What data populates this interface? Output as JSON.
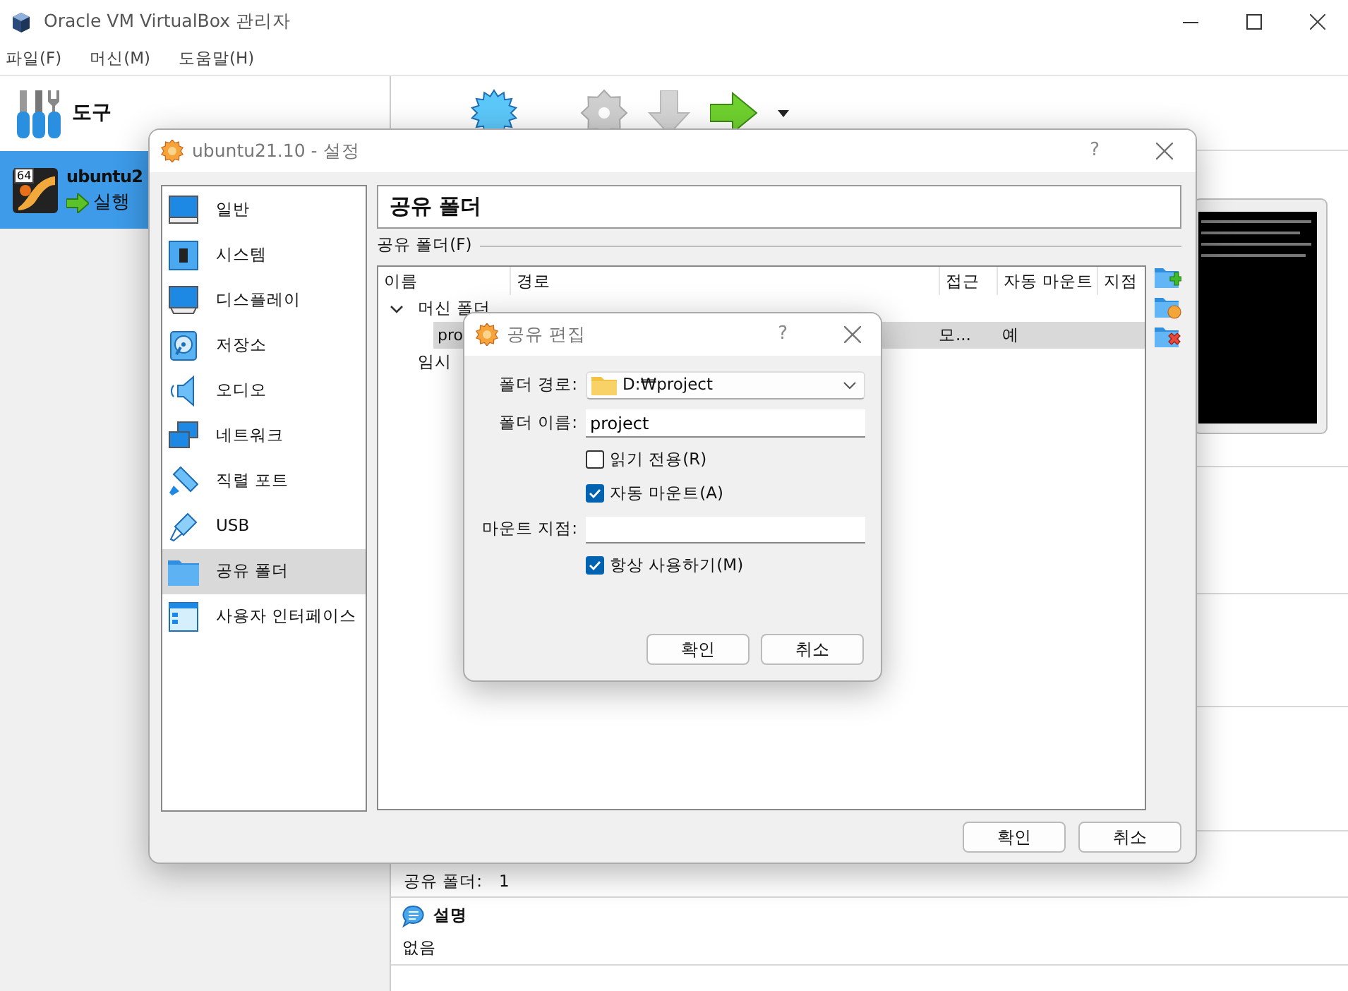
{
  "window": {
    "title": "Oracle VM VirtualBox 관리자"
  },
  "menu": [
    "파일(F)",
    "머신(M)",
    "도움말(H)"
  ],
  "sidebar": {
    "items": [
      {
        "kind": "tools",
        "label": "도구",
        "selected": false
      },
      {
        "kind": "vm",
        "label": "ubuntu2",
        "badge": "64",
        "status": "실행",
        "selected": true
      }
    ]
  },
  "details": {
    "shared_folders_label": "공유 폴더:",
    "shared_folders_value": "1",
    "description_heading": "설명",
    "description_text": "없음"
  },
  "settings_dialog": {
    "title": "ubuntu21.10 - 설정",
    "help": "?",
    "categories": [
      {
        "label": "일반",
        "selected": false
      },
      {
        "label": "시스템",
        "selected": false
      },
      {
        "label": "디스플레이",
        "selected": false
      },
      {
        "label": "저장소",
        "selected": false
      },
      {
        "label": "오디오",
        "selected": false
      },
      {
        "label": "네트워크",
        "selected": false
      },
      {
        "label": "직렬 포트",
        "selected": false
      },
      {
        "label": "USB",
        "selected": false
      },
      {
        "label": "공유 폴더",
        "selected": true
      },
      {
        "label": "사용자 인터페이스",
        "selected": false
      }
    ],
    "page_title": "공유 폴더",
    "group_label": "공유 폴더(F)",
    "table": {
      "columns": [
        "이름",
        "경로",
        "접근",
        "자동 마운트",
        "지점"
      ],
      "rows": [
        {
          "name": "머신 폴더",
          "expanded": true,
          "children": [
            {
              "name": "pro",
              "access": "모...",
              "auto_mount": "예",
              "selected": true
            }
          ]
        },
        {
          "name": "임시"
        }
      ]
    },
    "buttons": [
      "확인",
      "취소"
    ]
  },
  "edit_dialog": {
    "title": "공유 편집",
    "help": "?",
    "path_label": "폴더 경로:",
    "path_value": "D:₩project",
    "name_label": "폴더 이름:",
    "name_value": "project",
    "checks": [
      {
        "label": "읽기 전용(R)",
        "checked": false
      },
      {
        "label": "자동 마운트(A)",
        "checked": true
      }
    ],
    "mount_label": "마운트 지점:",
    "permanent": {
      "label": "항상 사용하기(M)",
      "checked": true
    },
    "buttons": [
      "확인",
      "취소"
    ]
  }
}
